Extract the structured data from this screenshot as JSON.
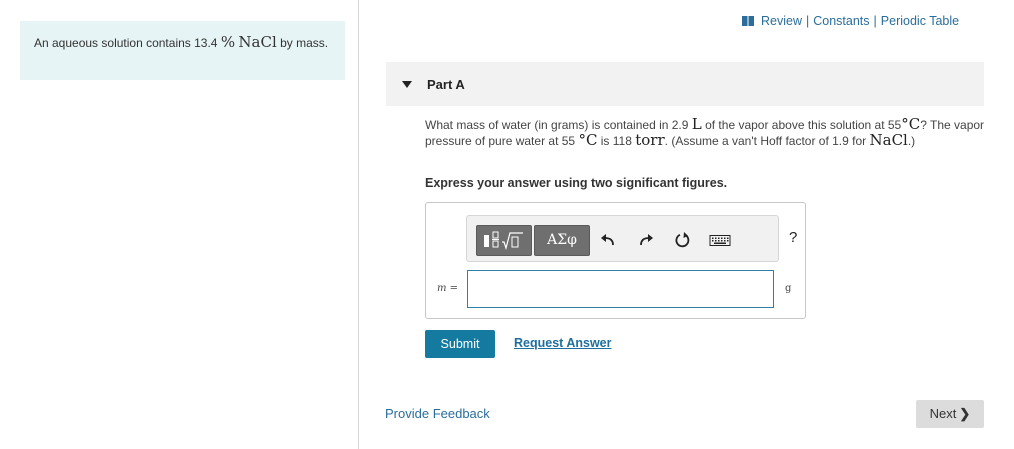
{
  "context": {
    "text_before": "An aqueous solution contains 13.4",
    "percent": "%",
    "formula": "NaCl",
    "text_after": "by mass."
  },
  "toplinks": {
    "review": "Review",
    "separator": "|",
    "constants": "Constants",
    "periodic_table": "Periodic Table",
    "icon": "book-icon"
  },
  "part": {
    "title": "Part A"
  },
  "question": {
    "q1": "What mass of water (in grams) is contained in 2.9",
    "unit_L": "L",
    "q2": "of the vapor above this solution at 55",
    "deg1": "°C",
    "q3": "? The vapor pressure of pure water at 55",
    "deg2": "°C",
    "q4": "is 118",
    "torr": "torr",
    "q5": ". (Assume a van't Hoff factor of 1.9 for",
    "nacl": "NaCl",
    "q6": ".)"
  },
  "instruction": "Express your answer using two significant figures.",
  "toolbar": {
    "greek_label": "ΑΣφ",
    "help_label": "?",
    "icons": [
      "templates-icon",
      "greek-symbols-icon",
      "undo-icon",
      "redo-icon",
      "reset-icon",
      "keyboard-icon",
      "help-icon"
    ]
  },
  "answer": {
    "variable": "m",
    "equals": "=",
    "value": "",
    "unit": "g"
  },
  "actions": {
    "submit": "Submit",
    "request_answer": "Request Answer",
    "provide_feedback": "Provide Feedback",
    "next": "Next",
    "next_chevron": "❯"
  },
  "colors": {
    "accent": "#157aa0",
    "link": "#2b6d9b",
    "context_bg": "#e7f4f6"
  }
}
